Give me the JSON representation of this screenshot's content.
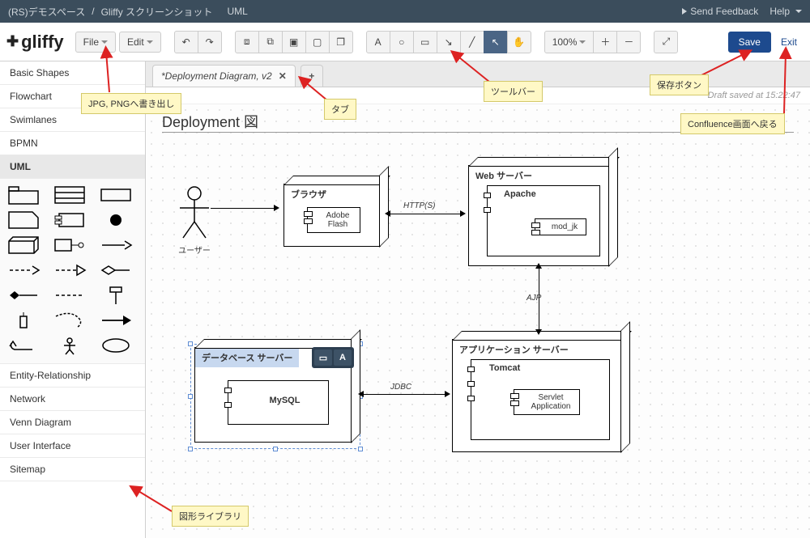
{
  "breadcrumb": {
    "space": "(RS)デモスペース",
    "page": "Gliffy スクリーンショット",
    "section": "UML",
    "sep": "/"
  },
  "header_links": {
    "feedback": "Send Feedback",
    "help": "Help"
  },
  "menus": {
    "file": "File",
    "edit": "Edit"
  },
  "zoom": {
    "level": "100%"
  },
  "actions": {
    "save": "Save",
    "exit": "Exit"
  },
  "tabs": {
    "current": "*Deployment Diagram, v2"
  },
  "status": {
    "draft_saved": "Draft saved at 15:22:47"
  },
  "diagram": {
    "title": "Deployment 図",
    "user_label": "ユーザー",
    "browser_title": "ブラウザ",
    "browser_component": "Adobe Flash",
    "web_title": "Web サーバー",
    "web_component": "Apache",
    "web_sub": "mod_jk",
    "db_title": "データベース サーバー",
    "db_component": "MySQL",
    "app_title": "アプリケーション サーバー",
    "app_component": "Tomcat",
    "app_sub": "Servlet Application",
    "edge_http": "HTTP(S)",
    "edge_ajp": "AJP",
    "edge_jdbc": "JDBC"
  },
  "sidebar": {
    "items": [
      "Basic Shapes",
      "Flowchart",
      "Swimlanes",
      "BPMN",
      "UML",
      "Entity-Relationship",
      "Network",
      "Venn Diagram",
      "User Interface",
      "Sitemap"
    ]
  },
  "callouts": {
    "export": "JPG, PNGへ書き出し",
    "tab": "タブ",
    "toolbar": "ツールバー",
    "save_btn": "保存ボタン",
    "return": "Confluence画面へ戻る",
    "library": "図形ライブラリ"
  },
  "mini_toolbar": {
    "a": "A"
  }
}
